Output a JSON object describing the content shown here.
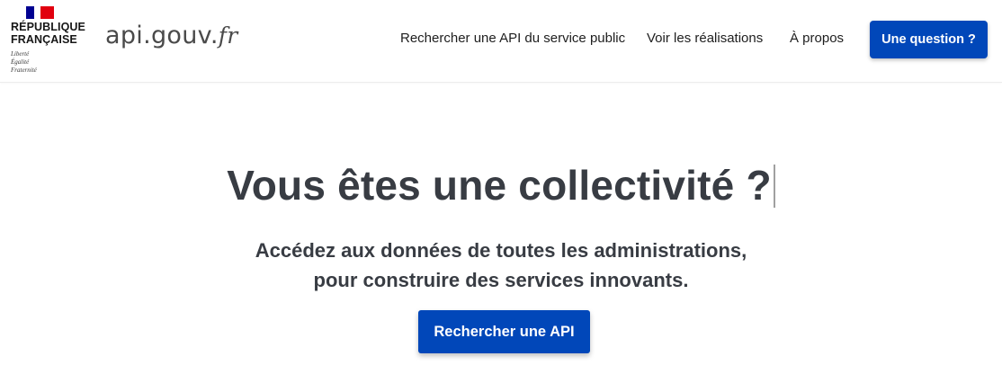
{
  "header": {
    "marianne": {
      "line1": "RÉPUBLIQUE",
      "line2": "FRANÇAISE",
      "motto": [
        "Liberté",
        "Égalité",
        "Fraternité"
      ],
      "flag_colors": [
        "#000091",
        "#ffffff",
        "#e1000f"
      ]
    },
    "brand": {
      "main": "api.gouv.",
      "tld": "fr"
    },
    "nav": {
      "search": "Rechercher une API du service public",
      "realisations": "Voir les réalisations",
      "about": "À propos"
    },
    "question_button": "Une question ?"
  },
  "hero": {
    "title": "Vous êtes une collectivité ?",
    "subtitle_line1": "Accédez aux données de toutes les administrations,",
    "subtitle_line2": "pour construire des services innovants.",
    "cta_button": "Rechercher une API"
  },
  "colors": {
    "primary": "#0147b9",
    "text_dark": "#383c43"
  }
}
